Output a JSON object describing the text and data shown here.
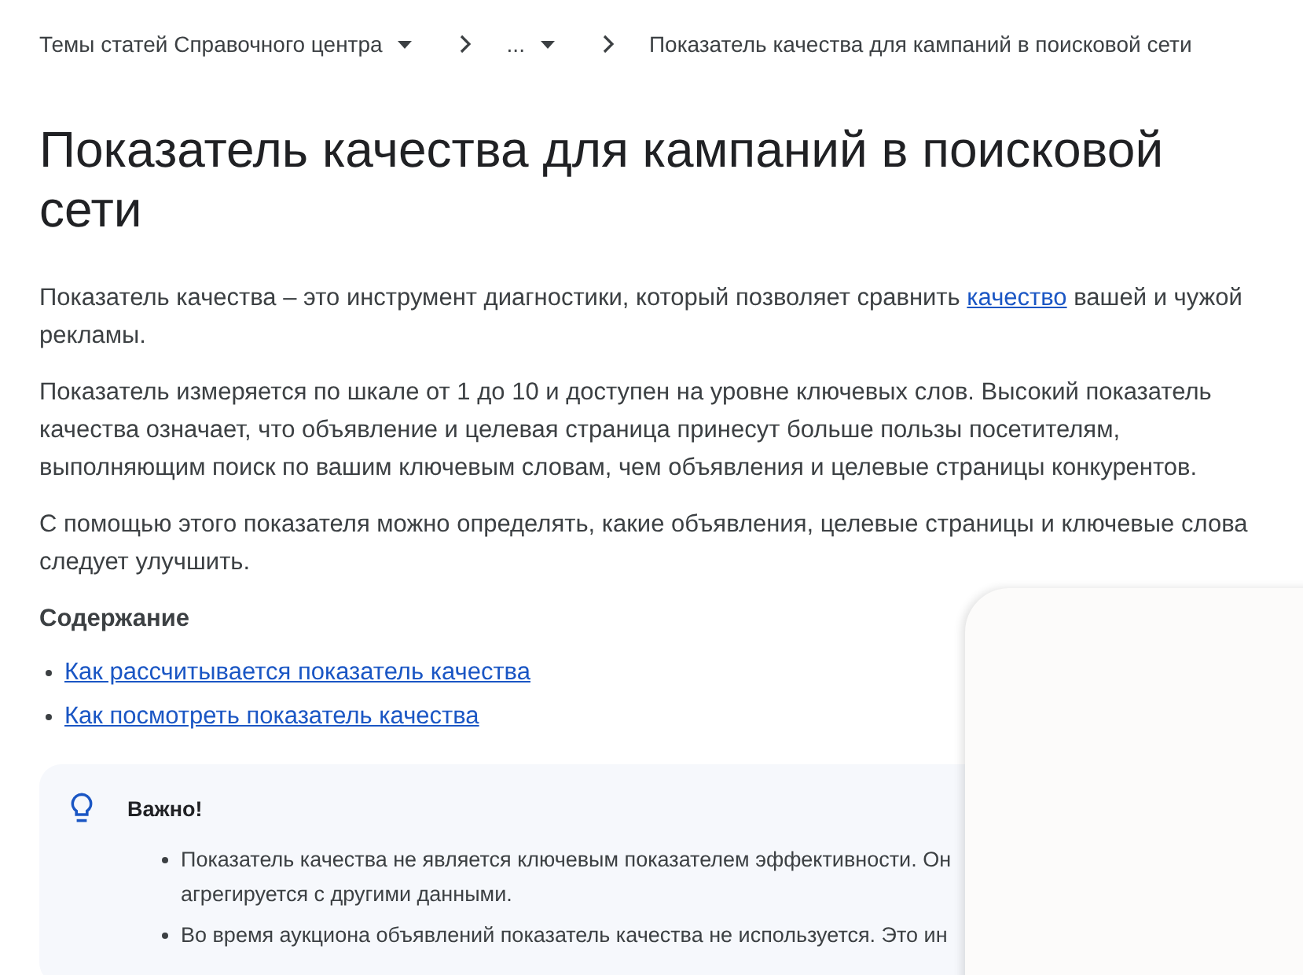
{
  "breadcrumb": [
    {
      "label": "Темы статей Справочного центра",
      "dropdown": true
    },
    {
      "label": "...",
      "dropdown": true
    },
    {
      "label": "Показатель качества для кампаний в поисковой сети",
      "dropdown": false
    }
  ],
  "title": "Показатель качества для кампаний в поисковой сети",
  "paragraphs": [
    [
      {
        "kind": "text",
        "text": "Показатель качества – это инструмент диагностики, который позволяет сравнить "
      },
      {
        "kind": "link",
        "text": "качество"
      },
      {
        "kind": "text",
        "text": " вашей и чужой рекламы."
      }
    ],
    [
      {
        "kind": "text",
        "text": "Показатель измеряется по шкале от 1 до 10 и доступен на уровне ключевых слов. Высокий показатель качества означает, что объявление и целевая страница принесут больше пользы посетителям, выполняющим поиск по вашим ключевым словам, чем объявления и целевые страницы конкурентов."
      }
    ],
    [
      {
        "kind": "text",
        "text": "С помощью этого показателя можно определять, какие объявления, целевые страницы и ключевые слова следует улучшить."
      }
    ]
  ],
  "contents": {
    "heading": "Содержание",
    "links": [
      "Как рассчитывается показатель качества",
      "Как посмотреть показатель качества"
    ]
  },
  "callout": {
    "title": "Важно!",
    "items": [
      [
        "Показатель качества не является ключевым показателем эффективности. Он",
        "агрегируется с другими данными."
      ],
      [
        "Во время аукциона объявлений показатель качества не используется. Это ин"
      ]
    ]
  }
}
